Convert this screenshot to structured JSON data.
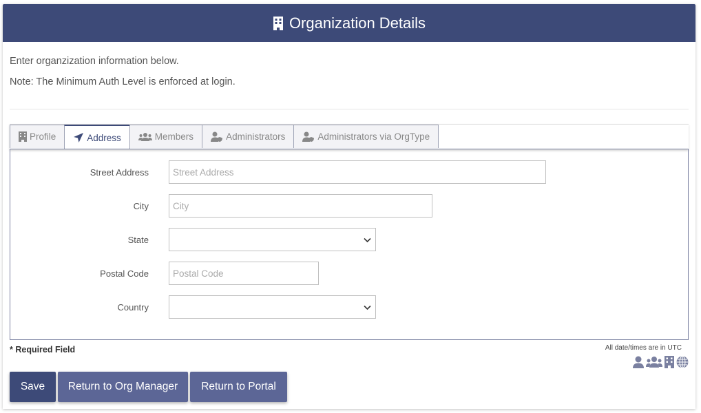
{
  "header": {
    "title": "Organization Details",
    "icon": "building-icon"
  },
  "intro": {
    "line1": "Enter organzization information below.",
    "line2": "Note: The Minimum Auth Level is enforced at login."
  },
  "tabs": [
    {
      "label": "Profile",
      "icon": "building-icon",
      "active": false
    },
    {
      "label": "Address",
      "icon": "location-arrow-icon",
      "active": true
    },
    {
      "label": "Members",
      "icon": "users-icon",
      "active": false
    },
    {
      "label": "Administrators",
      "icon": "user-shield-icon",
      "active": false
    },
    {
      "label": "Administrators via OrgType",
      "icon": "user-shield-icon",
      "active": false
    }
  ],
  "form": {
    "street": {
      "label": "Street Address",
      "placeholder": "Street Address",
      "value": ""
    },
    "city": {
      "label": "City",
      "placeholder": "City",
      "value": ""
    },
    "state": {
      "label": "State",
      "value": ""
    },
    "postal": {
      "label": "Postal Code",
      "placeholder": "Postal Code",
      "value": ""
    },
    "country": {
      "label": "Country",
      "value": ""
    }
  },
  "footer": {
    "required_note": "* Required Field",
    "utc_note": "All date/times are in UTC",
    "icons": [
      "user-icon",
      "users-icon",
      "building-icon",
      "globe-icon"
    ]
  },
  "buttons": {
    "save": "Save",
    "return_org": "Return to Org Manager",
    "return_portal": "Return to Portal"
  },
  "colors": {
    "primary": "#3d4a78",
    "secondary": "#5c6696",
    "icon_gray": "#7a80a0"
  }
}
